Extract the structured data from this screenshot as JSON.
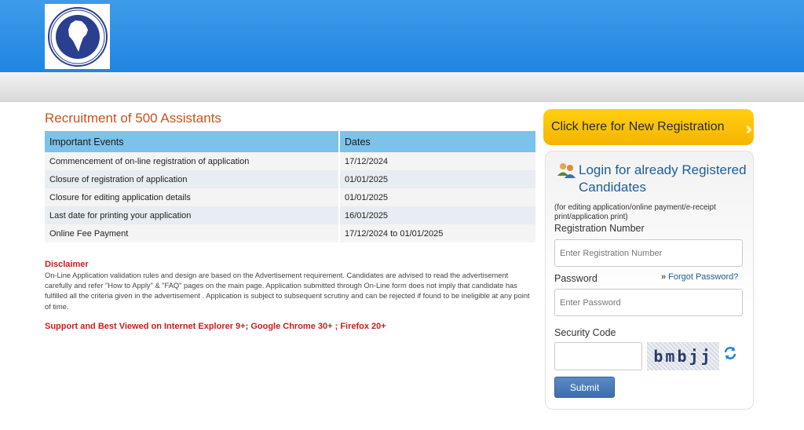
{
  "header": {
    "logo_icon": "new-india-assurance-logo",
    "logo_text": "THE NEW INDIA ASSURANCE CO. LTD."
  },
  "main": {
    "title": "Recruitment of 500 Assistants",
    "table": {
      "headers": [
        "Important Events",
        "Dates"
      ],
      "rows": [
        {
          "event": "Commencement of on-line registration of application",
          "date": "17/12/2024"
        },
        {
          "event": "Closure of registration of application",
          "date": "01/01/2025"
        },
        {
          "event": "Closure for editing application details",
          "date": "01/01/2025"
        },
        {
          "event": "Last date for printing your application",
          "date": "16/01/2025"
        },
        {
          "event": "Online Fee Payment",
          "date": "17/12/2024 to 01/01/2025"
        }
      ]
    },
    "disclaimer_title": "Disclaimer",
    "disclaimer_text": "On-Line Application validation rules and design are based on the Advertisement requirement. Candidates are advised to read the advertisement carefully and refer \"How to Apply\" & \"FAQ\" pages on the main page. Application submitted through On-Line form does not imply that candidate has fulfilled all the criteria given in the advertisement . Application is subject to subsequent scrutiny and can be rejected if found to be ineligible at any point of time.",
    "support_note": "Support and Best Viewed on Internet Explorer 9+; Google Chrome 30+ ; Firefox 20+"
  },
  "sidebar": {
    "new_registration_label": "Click here for New Registration",
    "login_heading": "Login for already Registered Candidates",
    "login_subtext": "(for editing application/online payment/e-receipt print/application print)",
    "registration_number_label": "Registration Number",
    "registration_number_placeholder": "Enter Registration Number",
    "password_label": "Password",
    "password_placeholder": "Enter Password",
    "forgot_password_label": "Forgot Password?",
    "security_code_label": "Security Code",
    "captcha_text": "bmbjj",
    "submit_label": "Submit"
  },
  "colors": {
    "header_blue": "#2b8fe5",
    "title_orange": "#c8541c",
    "table_header": "#7cc2ea",
    "disclaimer_red": "#c81e1e",
    "registration_yellow": "#f9c20a",
    "link_blue": "#1e5d94",
    "submit_blue": "#4a7cba"
  },
  "icons": {
    "login": "users-icon",
    "refresh": "refresh-icon",
    "forgot_chevron": "double-chevron-right-icon"
  }
}
